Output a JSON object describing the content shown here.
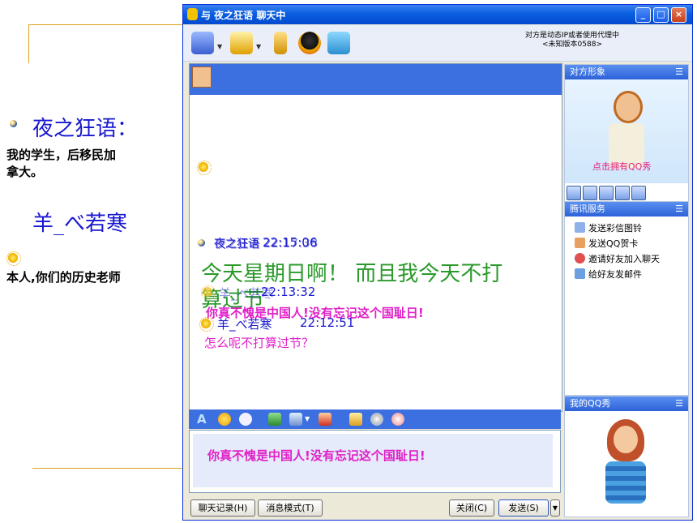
{
  "slide": {
    "user1": {
      "name": "夜之狂语：",
      "desc_line1": "我的学生，后移民加",
      "desc_line2": "拿大。"
    },
    "user2": {
      "name": "羊_べ若寒",
      "desc": "本人,你们的历史老师"
    }
  },
  "window": {
    "title": "与 夜之狂语 聊天中",
    "min": "_",
    "max": "□",
    "close": "×"
  },
  "toolbar": {
    "proxy_line1": "对方是动态IP或者使用代理中",
    "proxy_line2": "<未知版本0588>"
  },
  "chat": {
    "messages": [
      {
        "sender": "夜之狂语",
        "time": "22:15:06"
      },
      {
        "sender": "夜之狂语",
        "time": "22:17:38"
      },
      {
        "text": "今天星期日啊！ 而且我今天不打"
      },
      {
        "text": "算过节"
      },
      {
        "sender": "羊_べ若寒",
        "time": "22:13:32"
      },
      {
        "text": "你真不愧是中国人!没有忘记这个国耻日!"
      },
      {
        "sender": "羊_べ若寒",
        "time": "22:12:51"
      },
      {
        "text": "怎么呢不打算过节？"
      }
    ]
  },
  "input": {
    "text": "你真不愧是中国人!没有忘记这个国耻日!"
  },
  "buttons": {
    "history": "聊天记录(H)",
    "mode": "消息模式(T)",
    "close": "关闭(C)",
    "send": "发送(S)",
    "send_arrow": "▼"
  },
  "panels": {
    "duifang": {
      "title": "对方形象",
      "menu": "☰",
      "link": "点击拥有QQ秀"
    },
    "tencent": {
      "title": "腾讯服务",
      "menu": "☰",
      "items": [
        "发送彩信图铃",
        "发送QQ贺卡",
        "邀请好友加入聊天",
        "给好友发邮件"
      ]
    },
    "myshow": {
      "title": "我的QQ秀",
      "menu": "☰"
    }
  },
  "colors": {
    "titlebar": "#0a5fdf",
    "magenta": "#e020c8",
    "green": "#2a9a2a",
    "blue": "#1818d0"
  }
}
